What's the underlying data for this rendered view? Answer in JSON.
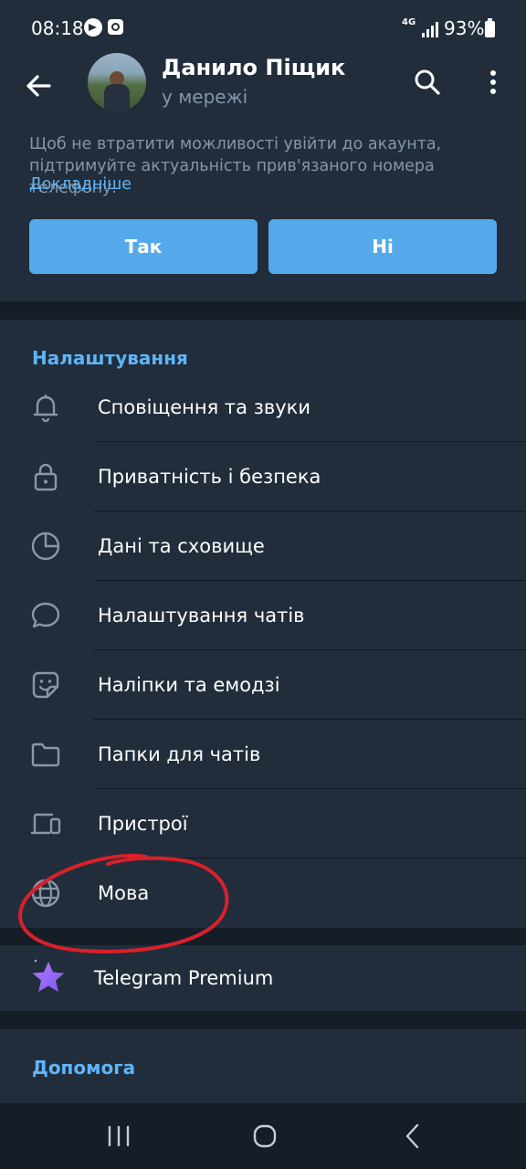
{
  "status_bar": {
    "time": "08:18",
    "network": "4G",
    "battery": "93%"
  },
  "header": {
    "name": "Данило Піщик",
    "status": "у мережі"
  },
  "banner": {
    "text": "Щоб не втратити можливості увійти до акаунта, підтримуйте актуальність прив'язаного номера телефону.",
    "link": "Докладніше",
    "yes_label": "Так",
    "no_label": "Ні"
  },
  "settings": {
    "title": "Налаштування",
    "items": [
      {
        "label": "Сповіщення та звуки",
        "icon": "bell-icon"
      },
      {
        "label": "Приватність і безпека",
        "icon": "lock-icon"
      },
      {
        "label": "Дані та сховище",
        "icon": "pie-chart-icon"
      },
      {
        "label": "Налаштування чатів",
        "icon": "chat-bubble-icon"
      },
      {
        "label": "Наліпки та емодзі",
        "icon": "sticker-icon"
      },
      {
        "label": "Папки для чатів",
        "icon": "folder-icon"
      },
      {
        "label": "Пристрої",
        "icon": "devices-icon"
      },
      {
        "label": "Мова",
        "icon": "globe-icon"
      }
    ]
  },
  "premium": {
    "label": "Telegram Premium",
    "icon": "premium-star-icon"
  },
  "help": {
    "title": "Допомога"
  },
  "colors": {
    "accent": "#5eb5f7",
    "button": "#54a9eb",
    "background": "#212d3b",
    "annotation": "#d9202b"
  }
}
